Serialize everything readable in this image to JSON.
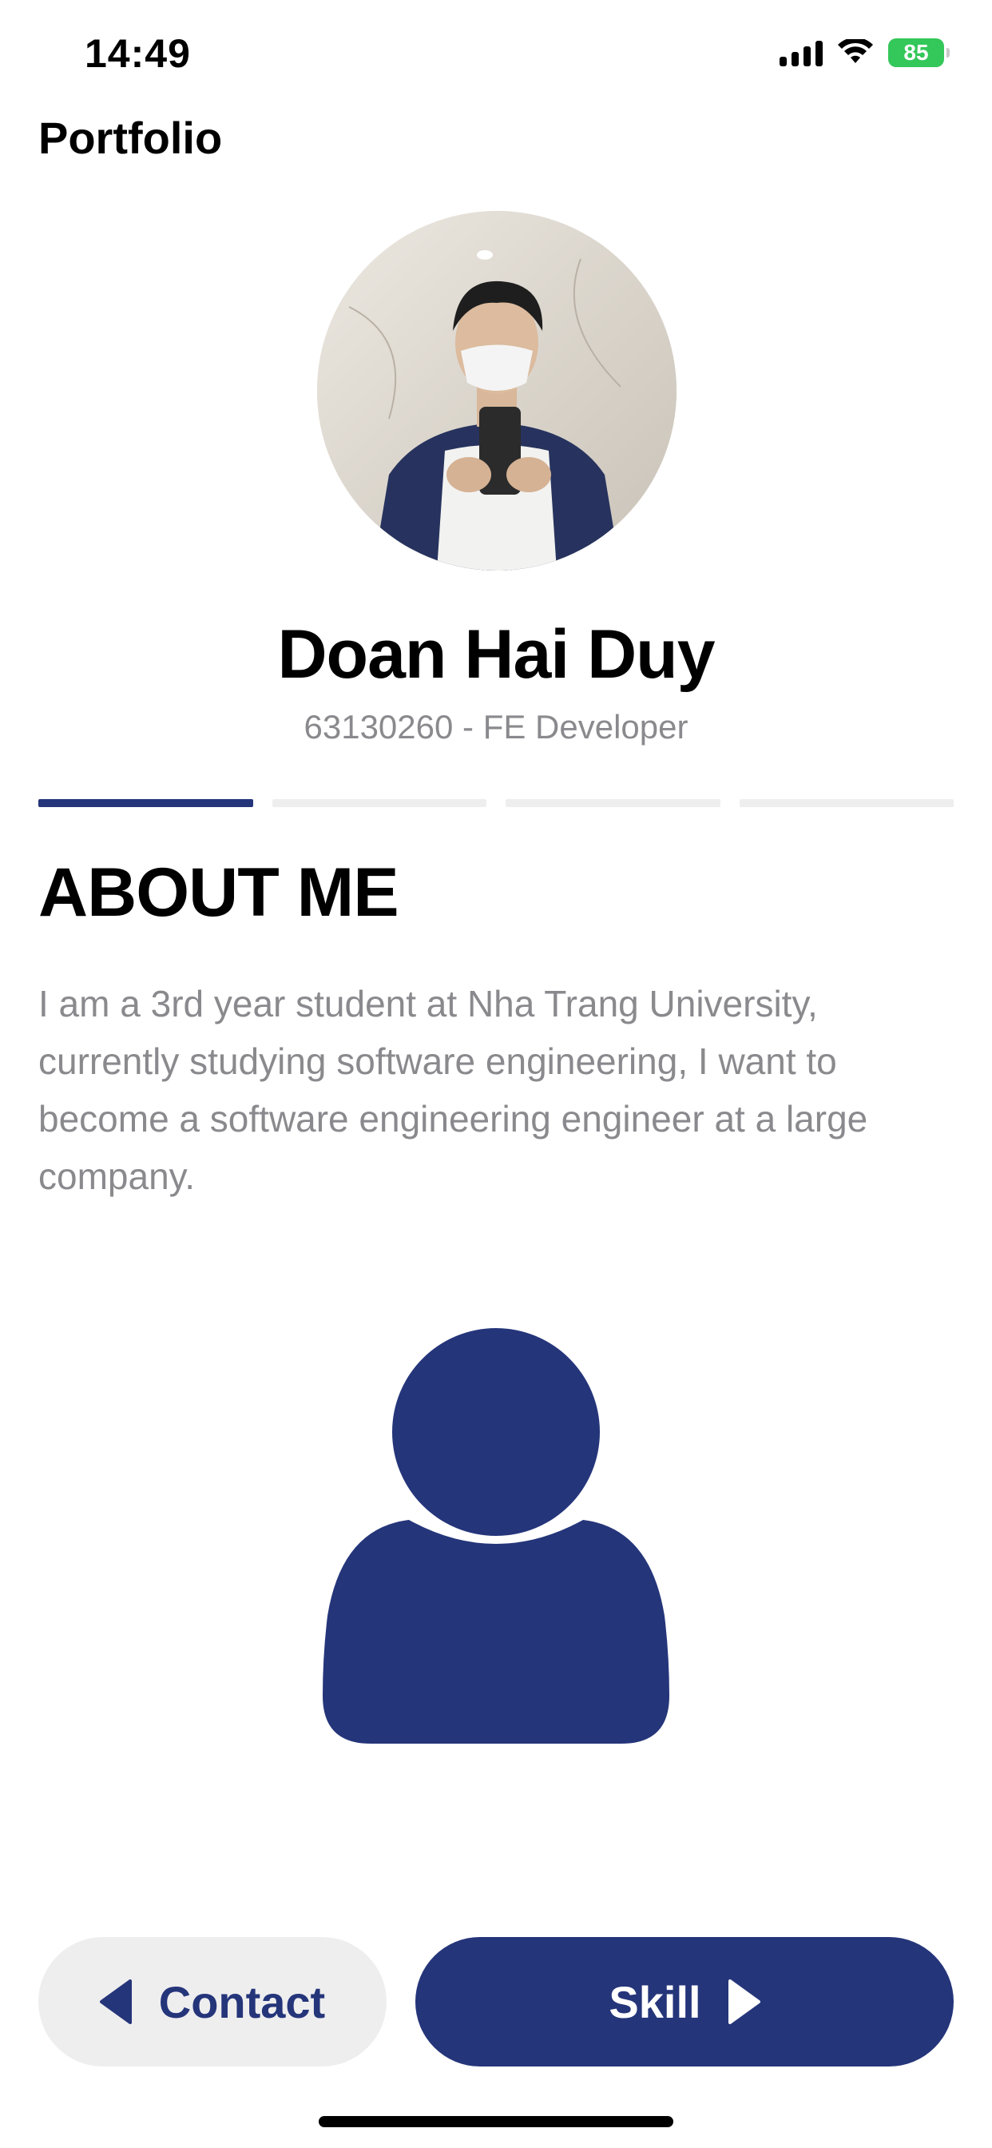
{
  "status_bar": {
    "time": "14:49",
    "battery": "85"
  },
  "header": {
    "title": "Portfolio"
  },
  "profile": {
    "name": "Doan Hai Duy",
    "subtitle": "63130260 - FE Developer"
  },
  "progress": {
    "steps_total": 4,
    "active_step": 1
  },
  "about": {
    "title": "ABOUT ME",
    "text": "I am a 3rd year student at Nha Trang University, currently studying software engineering, I want to become a software engineering engineer at a large company."
  },
  "nav": {
    "prev_label": "Contact",
    "next_label": "Skill"
  },
  "colors": {
    "accent": "#25357a",
    "muted_text": "#8a8a8e",
    "inactive_bg": "#eeeeef",
    "battery": "#34c759"
  },
  "icons": {
    "hero_icon": "person-icon",
    "prev_icon": "triangle-left-icon",
    "next_icon": "triangle-right-icon"
  }
}
